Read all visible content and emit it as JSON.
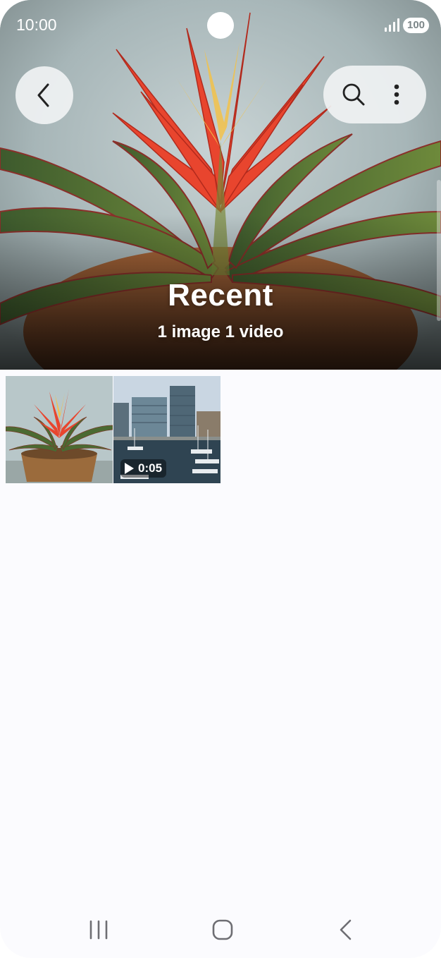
{
  "status_bar": {
    "time": "10:00",
    "battery": "100"
  },
  "toolbar": {
    "back_icon": "chevron-left-icon",
    "search_icon": "search-icon",
    "more_icon": "more-vertical-icon"
  },
  "album": {
    "title": "Recent",
    "subtitle": "1 image 1 video"
  },
  "items": [
    {
      "type": "image",
      "subject": "bromeliad plant in woven pot"
    },
    {
      "type": "video",
      "subject": "harbor with office buildings",
      "duration": "0:05"
    }
  ],
  "nav_bar": {
    "recents_icon": "recent-apps-icon",
    "home_icon": "home-icon",
    "back_icon": "back-icon"
  },
  "colors": {
    "background": "#fbfbfe",
    "button_bg": "#f0f2f3",
    "icon": "#222222",
    "nav_icon": "#6e6e73"
  }
}
